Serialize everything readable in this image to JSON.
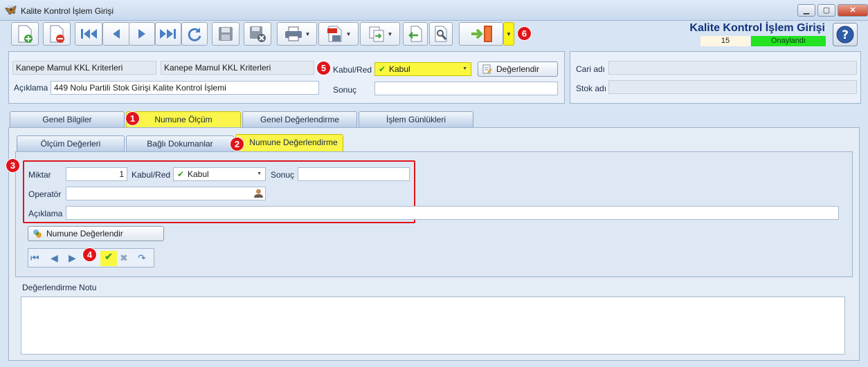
{
  "window": {
    "title": "Kalite Kontrol İşlem Girişi",
    "icon": "butterfly-icon"
  },
  "header": {
    "heading": "Kalite Kontrol İşlem Girişi",
    "record_number": "15",
    "status": "Onaylandı",
    "status_color": "#23e323"
  },
  "toolbar": {
    "buttons": [
      "new-icon",
      "delete-icon",
      "first-icon",
      "prev-icon",
      "next-icon",
      "last-icon",
      "refresh-icon",
      "save-icon",
      "cancel-save-icon",
      "print-icon",
      "pdf-icon",
      "export-icon",
      "import-icon",
      "settings-icon",
      "exit-icon"
    ]
  },
  "form": {
    "criteria_code": "Kanepe Mamul KKL Kriterleri",
    "criteria_name": "Kanepe Mamul KKL Kriterleri",
    "aciklama_label": "Açıklama",
    "aciklama_value": "449 Nolu Partili Stok Girişi Kalite Kontrol İşlemi",
    "kabul_red_label": "Kabul/Red",
    "kabul_red_value": "Kabul",
    "sonuc_label": "Sonuç",
    "sonuc_value": "",
    "evaluate_button": "Değerlendir"
  },
  "side": {
    "cari_label": "Cari adı",
    "cari_value": "",
    "stok_label": "Stok adı",
    "stok_value": ""
  },
  "tabs": [
    "Genel Bilgiler",
    "Numune Ölçüm",
    "Genel Değerlendirme",
    "İşlem Günlükleri"
  ],
  "subtabs": [
    "Ölçüm Değerleri",
    "Bağlı Dokumanlar",
    "Numune Değerlendirme"
  ],
  "sample": {
    "miktar_label": "Miktar",
    "miktar_value": "1",
    "kabul_red_label": "Kabul/Red",
    "kabul_red_value": "Kabul",
    "sonuc_label": "Sonuç",
    "sonuc_value": "",
    "operator_label": "Operatör",
    "operator_value": "",
    "aciklama_label": "Açıklama",
    "aciklama_value": "",
    "button": "Numune Değerlendir"
  },
  "notes": {
    "label": "Değerlendirme Notu",
    "value": ""
  },
  "badges": [
    "1",
    "2",
    "3",
    "4",
    "5",
    "6"
  ],
  "colors": {
    "highlight": "#f9f54a",
    "badge": "#e0141a",
    "heading": "#11317a"
  }
}
